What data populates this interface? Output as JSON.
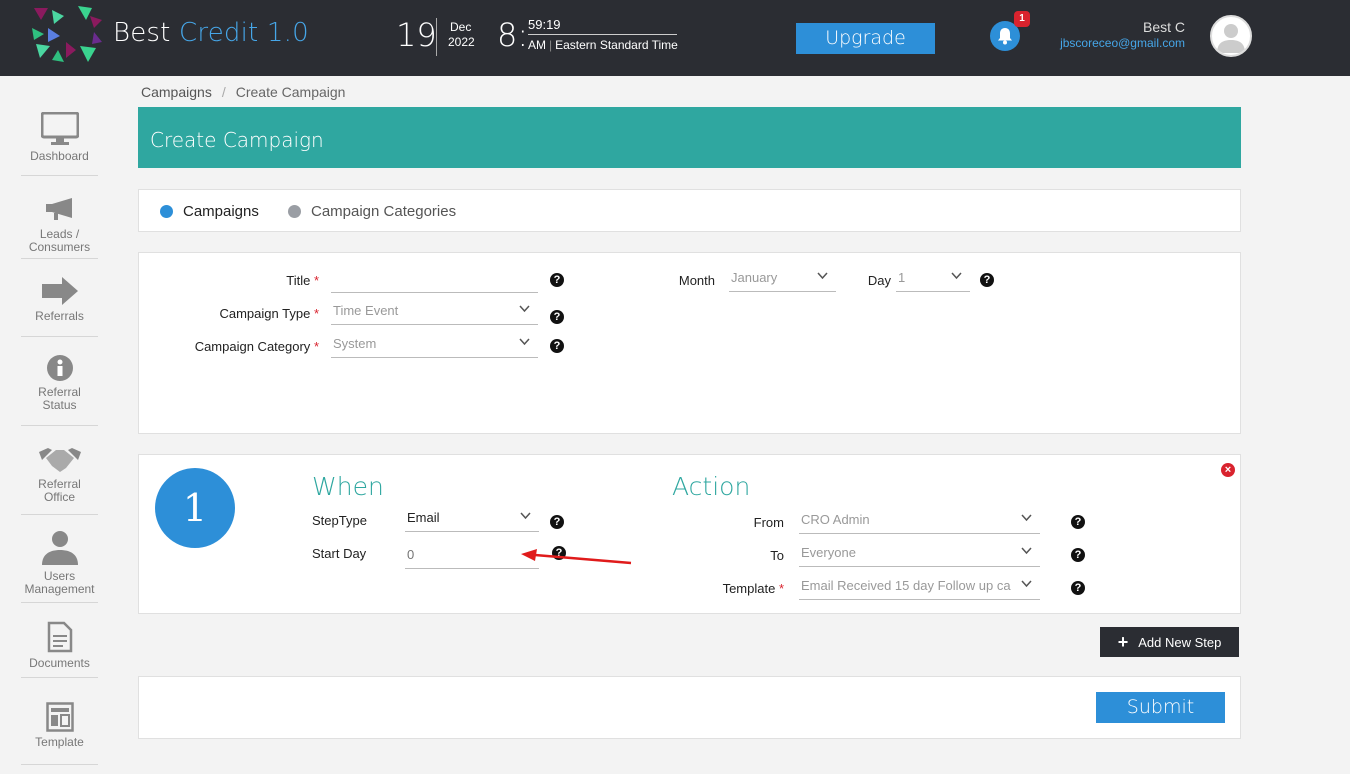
{
  "header": {
    "brand_main": "Best ",
    "brand_accent": "Credit 1.0",
    "date_day": "19",
    "date_month": "Dec",
    "date_year": "2022",
    "time_hour": "8:",
    "time_minsec": "59:19",
    "time_ampm": "AM",
    "timezone": "Eastern Standard Time",
    "upgrade_label": "Upgrade",
    "notification_count": "1",
    "user_name": "Best C",
    "user_email": "jbscoreceo@gmail.com"
  },
  "sidebar": {
    "items": [
      {
        "label": "Dashboard",
        "icon": "monitor-icon"
      },
      {
        "label": "Leads / Consumers",
        "icon": "megaphone-icon"
      },
      {
        "label": "Referrals",
        "icon": "arrow-right-icon"
      },
      {
        "label": "Referral Status",
        "icon": "info-icon"
      },
      {
        "label": "Referral Office",
        "icon": "handshake-icon"
      },
      {
        "label": "Users Management",
        "icon": "user-icon"
      },
      {
        "label": "Documents",
        "icon": "document-icon"
      },
      {
        "label": "Template",
        "icon": "template-icon"
      }
    ]
  },
  "breadcrumb": {
    "root": "Campaigns",
    "separator": "/",
    "current": "Create Campaign"
  },
  "page_title": "Create Campaign",
  "tabs": [
    {
      "label": "Campaigns",
      "active": true,
      "color": "#2d8fd8"
    },
    {
      "label": "Campaign Categories",
      "active": false,
      "color": "#9a9ea4"
    }
  ],
  "form": {
    "title_label": "Title",
    "title_value": "",
    "campaign_type_label": "Campaign Type",
    "campaign_type_value": "Time Event",
    "campaign_category_label": "Campaign Category",
    "campaign_category_value": "System",
    "month_label": "Month",
    "month_value": "January",
    "day_label": "Day",
    "day_value": "1",
    "required_mark": "*",
    "help_glyph": "?"
  },
  "step": {
    "number": "1",
    "when_title": "When",
    "steptype_label": "StepType",
    "steptype_value": "Email",
    "start_day_label": "Start Day",
    "start_day_placeholder": "0",
    "action_title": "Action",
    "from_label": "From",
    "from_value": "CRO Admin",
    "to_label": "To",
    "to_value": "Everyone",
    "template_label": "Template",
    "template_value": "Email Received 15 day Follow up ca"
  },
  "buttons": {
    "add_new_step": "Add New Step",
    "submit": "Submit"
  },
  "colors": {
    "accent_blue": "#2d8fd8",
    "teal": "#2fa7a0",
    "danger": "#d9232e",
    "topbar": "#2b2d33"
  }
}
